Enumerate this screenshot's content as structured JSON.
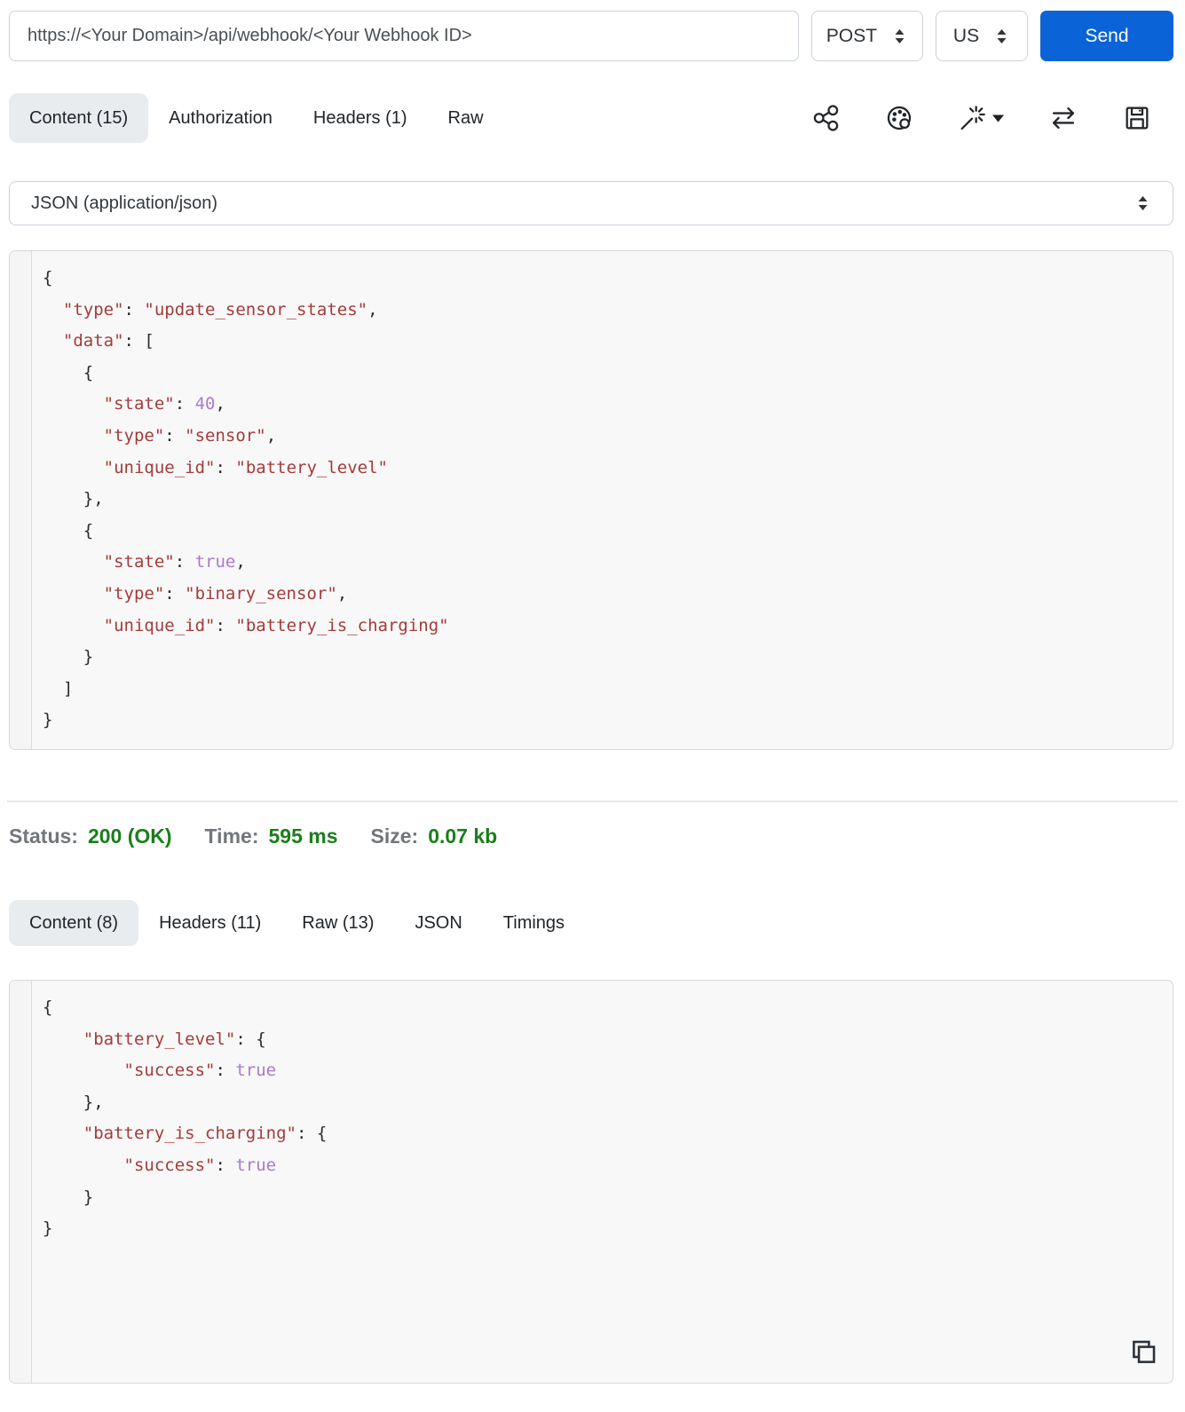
{
  "colors": {
    "accent_blue": "#0b63d8",
    "success_green": "#1b7e1b",
    "json_string": "#a33b3b",
    "json_literal": "#a87bc9"
  },
  "request_bar": {
    "url": "https://<Your Domain>/api/webhook/<Your Webhook ID>",
    "method": "POST",
    "locale": "US",
    "send_label": "Send"
  },
  "request_tabs": [
    {
      "label": "Content (15)"
    },
    {
      "label": "Authorization"
    },
    {
      "label": "Headers (1)"
    },
    {
      "label": "Raw"
    }
  ],
  "toolbar": {
    "icons": [
      "share-icon",
      "palette-icon",
      "magic-wand-icon",
      "swap-arrows-icon",
      "save-icon"
    ]
  },
  "body_type_select": {
    "value": "JSON (application/json)"
  },
  "request_body": {
    "lines": [
      [
        [
          "p",
          "{"
        ]
      ],
      [
        [
          "p",
          "  "
        ],
        [
          "s",
          "\"type\""
        ],
        [
          "p",
          ": "
        ],
        [
          "s",
          "\"update_sensor_states\""
        ],
        [
          "p",
          ","
        ]
      ],
      [
        [
          "p",
          "  "
        ],
        [
          "s",
          "\"data\""
        ],
        [
          "p",
          ": ["
        ]
      ],
      [
        [
          "p",
          "    {"
        ]
      ],
      [
        [
          "p",
          "      "
        ],
        [
          "s",
          "\"state\""
        ],
        [
          "p",
          ": "
        ],
        [
          "l",
          "40"
        ],
        [
          "p",
          ","
        ]
      ],
      [
        [
          "p",
          "      "
        ],
        [
          "s",
          "\"type\""
        ],
        [
          "p",
          ": "
        ],
        [
          "s",
          "\"sensor\""
        ],
        [
          "p",
          ","
        ]
      ],
      [
        [
          "p",
          "      "
        ],
        [
          "s",
          "\"unique_id\""
        ],
        [
          "p",
          ": "
        ],
        [
          "s",
          "\"battery_level\""
        ]
      ],
      [
        [
          "p",
          "    },"
        ]
      ],
      [
        [
          "p",
          "    {"
        ]
      ],
      [
        [
          "p",
          "      "
        ],
        [
          "s",
          "\"state\""
        ],
        [
          "p",
          ": "
        ],
        [
          "l",
          "true"
        ],
        [
          "p",
          ","
        ]
      ],
      [
        [
          "p",
          "      "
        ],
        [
          "s",
          "\"type\""
        ],
        [
          "p",
          ": "
        ],
        [
          "s",
          "\"binary_sensor\""
        ],
        [
          "p",
          ","
        ]
      ],
      [
        [
          "p",
          "      "
        ],
        [
          "s",
          "\"unique_id\""
        ],
        [
          "p",
          ": "
        ],
        [
          "s",
          "\"battery_is_charging\""
        ]
      ],
      [
        [
          "p",
          "    }"
        ]
      ],
      [
        [
          "p",
          "  ]"
        ]
      ],
      [
        [
          "p",
          "}"
        ]
      ]
    ]
  },
  "status_bar": {
    "status_label": "Status:",
    "status_value": "200 (OK)",
    "time_label": "Time:",
    "time_value": "595 ms",
    "size_label": "Size:",
    "size_value": "0.07 kb"
  },
  "response_tabs": [
    {
      "label": "Content (8)"
    },
    {
      "label": "Headers (11)"
    },
    {
      "label": "Raw (13)"
    },
    {
      "label": "JSON"
    },
    {
      "label": "Timings"
    }
  ],
  "response_body": {
    "lines": [
      [
        [
          "p",
          "{"
        ]
      ],
      [
        [
          "p",
          "    "
        ],
        [
          "s",
          "\"battery_level\""
        ],
        [
          "p",
          ": {"
        ]
      ],
      [
        [
          "p",
          "        "
        ],
        [
          "s",
          "\"success\""
        ],
        [
          "p",
          ": "
        ],
        [
          "l",
          "true"
        ]
      ],
      [
        [
          "p",
          "    },"
        ]
      ],
      [
        [
          "p",
          "    "
        ],
        [
          "s",
          "\"battery_is_charging\""
        ],
        [
          "p",
          ": {"
        ]
      ],
      [
        [
          "p",
          "        "
        ],
        [
          "s",
          "\"success\""
        ],
        [
          "p",
          ": "
        ],
        [
          "l",
          "true"
        ]
      ],
      [
        [
          "p",
          "    }"
        ]
      ],
      [
        [
          "p",
          "}"
        ]
      ]
    ]
  }
}
